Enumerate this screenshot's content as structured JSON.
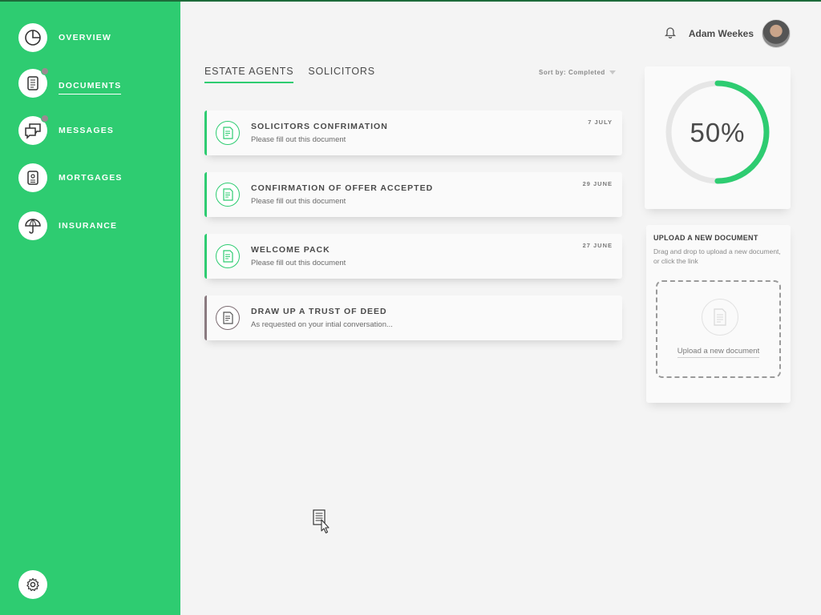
{
  "sidebar": {
    "items": [
      {
        "label": "OVERVIEW",
        "icon": "pie-chart-icon"
      },
      {
        "label": "DOCUMENTS",
        "icon": "document-icon"
      },
      {
        "label": "MESSAGES",
        "icon": "chat-icon"
      },
      {
        "label": "MORTGAGES",
        "icon": "id-card-icon"
      },
      {
        "label": "INSURANCE",
        "icon": "umbrella-icon"
      }
    ],
    "settings_icon": "gear-icon",
    "active_index": 1
  },
  "header": {
    "user_name": "Adam Weekes",
    "bell_icon": "bell-icon"
  },
  "tabs": [
    {
      "label": "ESTATE AGENTS"
    },
    {
      "label": "SOLICITORS"
    }
  ],
  "sort": {
    "label": "Sort by: Completed"
  },
  "documents": [
    {
      "title": "SOLICITORS CONFRIMATION",
      "subtitle": "Please fill out this document",
      "date": "7 JULY"
    },
    {
      "title": "CONFIRMATION OF OFFER ACCEPTED",
      "subtitle": "Please fill out this document",
      "date": "29 JUNE"
    },
    {
      "title": "WELCOME PACK",
      "subtitle": "Please fill out this document",
      "date": "27 JUNE"
    },
    {
      "title": "DRAW UP A TRUST OF DEED",
      "subtitle": "As requested on your intial conversation...",
      "date": ""
    }
  ],
  "progress": {
    "label": "50%",
    "value": 0.5
  },
  "upload": {
    "title": "UPLOAD A NEW DOCUMENT",
    "description": "Drag and drop to upload a new document, or click the link",
    "link": "Upload a new document"
  },
  "colors": {
    "accent": "#2ecc71",
    "muted": "#8a7a80",
    "text": "#4a4a4a"
  }
}
